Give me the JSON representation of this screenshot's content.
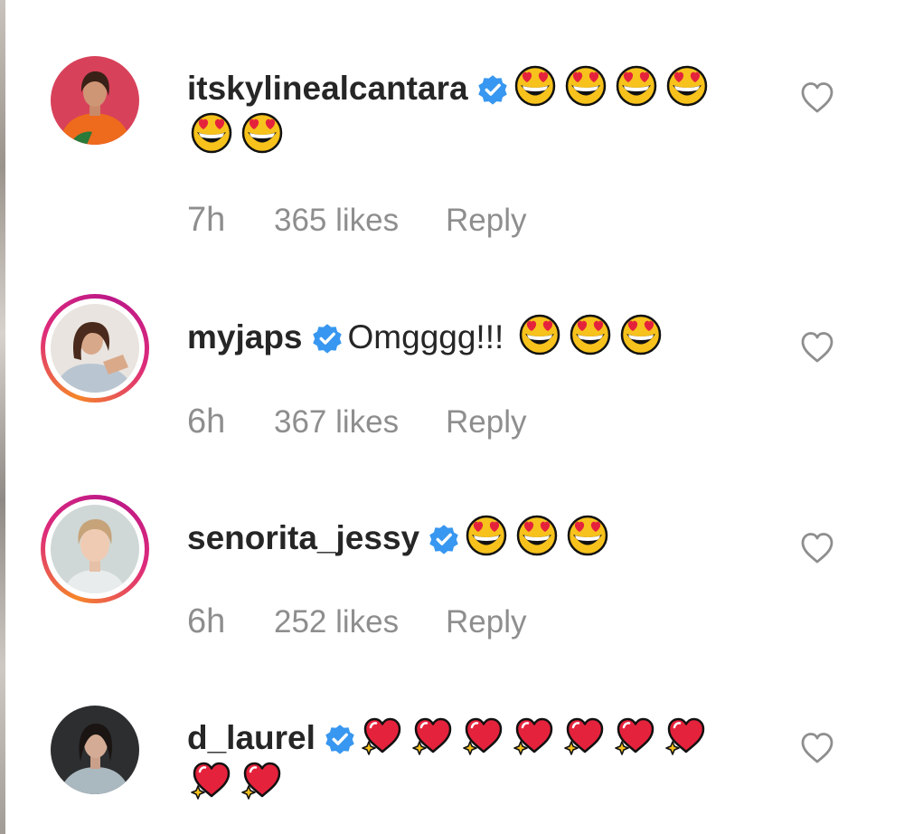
{
  "comments": [
    {
      "username": "itskylinealcantara",
      "verified": true,
      "text": "",
      "emoji_icons": [
        "heart-eyes-emoji",
        "heart-eyes-emoji",
        "heart-eyes-emoji",
        "heart-eyes-emoji",
        "heart-eyes-emoji",
        "heart-eyes-emoji"
      ],
      "time": "7h",
      "likes": "365 likes",
      "reply_label": "Reply"
    },
    {
      "username": "myjaps",
      "verified": true,
      "text": "Omgggg!!!",
      "emoji_icons": [
        "heart-eyes-emoji",
        "heart-eyes-emoji",
        "heart-eyes-emoji"
      ],
      "time": "6h",
      "likes": "367 likes",
      "reply_label": "Reply"
    },
    {
      "username": "senorita_jessy",
      "verified": true,
      "text": "",
      "emoji_icons": [
        "heart-eyes-emoji",
        "heart-eyes-emoji",
        "heart-eyes-emoji"
      ],
      "time": "6h",
      "likes": "252 likes",
      "reply_label": "Reply"
    },
    {
      "username": "d_laurel",
      "verified": true,
      "text": "",
      "emoji_icons": [
        "sparkling-heart-emoji",
        "sparkling-heart-emoji",
        "sparkling-heart-emoji",
        "sparkling-heart-emoji",
        "sparkling-heart-emoji",
        "sparkling-heart-emoji",
        "sparkling-heart-emoji",
        "sparkling-heart-emoji",
        "sparkling-heart-emoji"
      ]
    }
  ],
  "colors": {
    "verified_badge": "#3897f0",
    "meta_text": "#8e8e8e",
    "username_text": "#262626",
    "story_ring_start": "#f58529",
    "story_ring_end": "#dd2a7b"
  }
}
